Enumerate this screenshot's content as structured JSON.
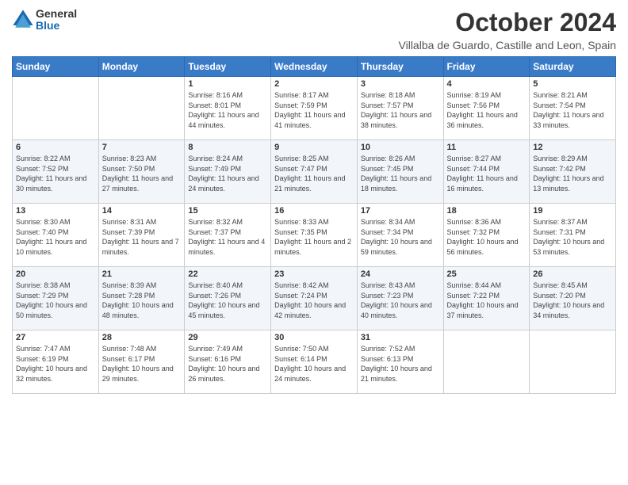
{
  "logo": {
    "general": "General",
    "blue": "Blue"
  },
  "title": "October 2024",
  "subtitle": "Villalba de Guardo, Castille and Leon, Spain",
  "days_of_week": [
    "Sunday",
    "Monday",
    "Tuesday",
    "Wednesday",
    "Thursday",
    "Friday",
    "Saturday"
  ],
  "weeks": [
    [
      {
        "day": "",
        "info": ""
      },
      {
        "day": "",
        "info": ""
      },
      {
        "day": "1",
        "info": "Sunrise: 8:16 AM\nSunset: 8:01 PM\nDaylight: 11 hours and 44 minutes."
      },
      {
        "day": "2",
        "info": "Sunrise: 8:17 AM\nSunset: 7:59 PM\nDaylight: 11 hours and 41 minutes."
      },
      {
        "day": "3",
        "info": "Sunrise: 8:18 AM\nSunset: 7:57 PM\nDaylight: 11 hours and 38 minutes."
      },
      {
        "day": "4",
        "info": "Sunrise: 8:19 AM\nSunset: 7:56 PM\nDaylight: 11 hours and 36 minutes."
      },
      {
        "day": "5",
        "info": "Sunrise: 8:21 AM\nSunset: 7:54 PM\nDaylight: 11 hours and 33 minutes."
      }
    ],
    [
      {
        "day": "6",
        "info": "Sunrise: 8:22 AM\nSunset: 7:52 PM\nDaylight: 11 hours and 30 minutes."
      },
      {
        "day": "7",
        "info": "Sunrise: 8:23 AM\nSunset: 7:50 PM\nDaylight: 11 hours and 27 minutes."
      },
      {
        "day": "8",
        "info": "Sunrise: 8:24 AM\nSunset: 7:49 PM\nDaylight: 11 hours and 24 minutes."
      },
      {
        "day": "9",
        "info": "Sunrise: 8:25 AM\nSunset: 7:47 PM\nDaylight: 11 hours and 21 minutes."
      },
      {
        "day": "10",
        "info": "Sunrise: 8:26 AM\nSunset: 7:45 PM\nDaylight: 11 hours and 18 minutes."
      },
      {
        "day": "11",
        "info": "Sunrise: 8:27 AM\nSunset: 7:44 PM\nDaylight: 11 hours and 16 minutes."
      },
      {
        "day": "12",
        "info": "Sunrise: 8:29 AM\nSunset: 7:42 PM\nDaylight: 11 hours and 13 minutes."
      }
    ],
    [
      {
        "day": "13",
        "info": "Sunrise: 8:30 AM\nSunset: 7:40 PM\nDaylight: 11 hours and 10 minutes."
      },
      {
        "day": "14",
        "info": "Sunrise: 8:31 AM\nSunset: 7:39 PM\nDaylight: 11 hours and 7 minutes."
      },
      {
        "day": "15",
        "info": "Sunrise: 8:32 AM\nSunset: 7:37 PM\nDaylight: 11 hours and 4 minutes."
      },
      {
        "day": "16",
        "info": "Sunrise: 8:33 AM\nSunset: 7:35 PM\nDaylight: 11 hours and 2 minutes."
      },
      {
        "day": "17",
        "info": "Sunrise: 8:34 AM\nSunset: 7:34 PM\nDaylight: 10 hours and 59 minutes."
      },
      {
        "day": "18",
        "info": "Sunrise: 8:36 AM\nSunset: 7:32 PM\nDaylight: 10 hours and 56 minutes."
      },
      {
        "day": "19",
        "info": "Sunrise: 8:37 AM\nSunset: 7:31 PM\nDaylight: 10 hours and 53 minutes."
      }
    ],
    [
      {
        "day": "20",
        "info": "Sunrise: 8:38 AM\nSunset: 7:29 PM\nDaylight: 10 hours and 50 minutes."
      },
      {
        "day": "21",
        "info": "Sunrise: 8:39 AM\nSunset: 7:28 PM\nDaylight: 10 hours and 48 minutes."
      },
      {
        "day": "22",
        "info": "Sunrise: 8:40 AM\nSunset: 7:26 PM\nDaylight: 10 hours and 45 minutes."
      },
      {
        "day": "23",
        "info": "Sunrise: 8:42 AM\nSunset: 7:24 PM\nDaylight: 10 hours and 42 minutes."
      },
      {
        "day": "24",
        "info": "Sunrise: 8:43 AM\nSunset: 7:23 PM\nDaylight: 10 hours and 40 minutes."
      },
      {
        "day": "25",
        "info": "Sunrise: 8:44 AM\nSunset: 7:22 PM\nDaylight: 10 hours and 37 minutes."
      },
      {
        "day": "26",
        "info": "Sunrise: 8:45 AM\nSunset: 7:20 PM\nDaylight: 10 hours and 34 minutes."
      }
    ],
    [
      {
        "day": "27",
        "info": "Sunrise: 7:47 AM\nSunset: 6:19 PM\nDaylight: 10 hours and 32 minutes."
      },
      {
        "day": "28",
        "info": "Sunrise: 7:48 AM\nSunset: 6:17 PM\nDaylight: 10 hours and 29 minutes."
      },
      {
        "day": "29",
        "info": "Sunrise: 7:49 AM\nSunset: 6:16 PM\nDaylight: 10 hours and 26 minutes."
      },
      {
        "day": "30",
        "info": "Sunrise: 7:50 AM\nSunset: 6:14 PM\nDaylight: 10 hours and 24 minutes."
      },
      {
        "day": "31",
        "info": "Sunrise: 7:52 AM\nSunset: 6:13 PM\nDaylight: 10 hours and 21 minutes."
      },
      {
        "day": "",
        "info": ""
      },
      {
        "day": "",
        "info": ""
      }
    ]
  ]
}
